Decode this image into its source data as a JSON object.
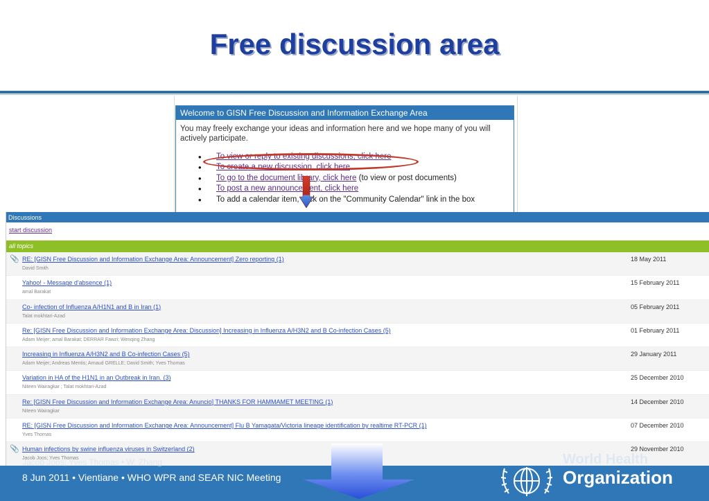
{
  "slide": {
    "title": "Free discussion area"
  },
  "welcome": {
    "header": "Welcome to GISN Free Discussion and Information Exchange Area",
    "intro": "You may freely exchange your ideas and information here and we hope many of you will actively participate.",
    "items": [
      {
        "link": "To view or reply to existing discussions, click here",
        "suffix": ""
      },
      {
        "link": "To create a new discussion, click here",
        "suffix": ""
      },
      {
        "link": "To go to the document library, click here",
        "suffix": " (to view or post documents)"
      },
      {
        "link": "To post a new announcement, click here",
        "suffix": ""
      },
      {
        "link": "",
        "suffix": "To add a calendar item, click on the \"Community Calendar\" link in the box"
      }
    ]
  },
  "discussions": {
    "header": "Discussions",
    "start_link": "start discussion",
    "section_label": "all topics",
    "rows": [
      {
        "topic": "RE: [GISN Free Discussion and Information Exchange Area: Announcement] Zero reporting (1)",
        "authors": "David Smith",
        "date": "18 May 2011",
        "attachment": true
      },
      {
        "topic": "Yahoo! - Message d'absence (1)",
        "authors": "amal Barakat",
        "date": "15 February 2011",
        "attachment": false
      },
      {
        "topic": "Co- infection of Influenza A/H1N1 and B in Iran (1)",
        "authors": "Talat mokhtari-Azad",
        "date": "05 February 2011",
        "attachment": false
      },
      {
        "topic": "Re: [GISN Free Discussion and Information Exchange Area: Discussion] Increasing in Influenza A/H3N2 and B Co-infection Cases (5)",
        "authors": "Adam Meijer; amal Barakat; DERRAR Fawzi; Wenqing Zhang",
        "date": "01 February 2011",
        "attachment": false
      },
      {
        "topic": "Increasing in Influenza A/H3N2 and B Co-infection Cases (5)",
        "authors": "Adam Meijer; Andreas Mentis; Arnaud GRELLE; David Smith; Yves Thomas",
        "date": "29 January 2011",
        "attachment": false
      },
      {
        "topic": "Variation in HA of the H1N1 in an Outbreak in Iran. (3)",
        "authors": "Niteen Wairagkar ; Talat mokhtari-Azad",
        "date": "25 December 2010",
        "attachment": false
      },
      {
        "topic": "Re: [GISN Free Discussion and Information Exchange Area: Anuncio] THANKS FOR HAMMAMET MEETING (1)",
        "authors": "Niteen Wairagkar",
        "date": "14 December 2010",
        "attachment": false
      },
      {
        "topic": "RE: [GISN Free Discussion and Information Exchange Area: Announcement] Flu B Yamagata/Victoria lineage identification by realtime RT-PCR (1)",
        "authors": "Yves Thomas",
        "date": "07 December 2010",
        "attachment": false
      },
      {
        "topic": "Human infections by swine influenza viruses in Switzerland (2)",
        "authors": "Jacob Joos; Yves Thomas",
        "date": "29 November 2010",
        "attachment": true
      }
    ]
  },
  "footer": {
    "line1": "Jacob Joos; Yves Thomas  •  W. Zhang",
    "line2": "8 Jun 2011 • Vientiane • WHO WPR and SEAR NIC Meeting",
    "org_top": "World Health",
    "org": "Organization"
  },
  "colors": {
    "title": "#1f3f9e",
    "header_blue": "#2f77b7",
    "topics_green": "#8fbf26",
    "link_blue": "#2b4fc7",
    "oval_red": "#c0392b"
  }
}
